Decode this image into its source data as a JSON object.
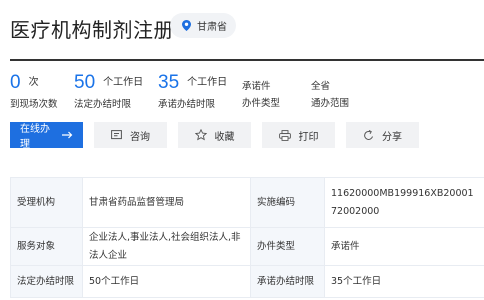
{
  "header": {
    "title": "医疗机构制剂注册",
    "location": "甘肃省"
  },
  "stats": [
    {
      "value": "0",
      "unit": "次",
      "label": "到现场次数"
    },
    {
      "value": "50",
      "unit": "个工作日",
      "label": "法定办结时限"
    },
    {
      "value": "35",
      "unit": "个工作日",
      "label": "承诺办结时限"
    },
    {
      "text": "承诺件",
      "label": "办件类型"
    },
    {
      "text": "全省",
      "label": "通办范围"
    }
  ],
  "actions": {
    "apply": "在线办理",
    "consult": "咨询",
    "favorite": "收藏",
    "print": "打印",
    "share": "分享"
  },
  "info": {
    "rows": [
      {
        "k1": "受理机构",
        "v1": "甘肃省药品监督管理局",
        "k2": "实施编码",
        "v2": "11620000MB199916XB2000172002000"
      },
      {
        "k1": "服务对象",
        "v1": "企业法人,事业法人,社会组织法人,非法人企业",
        "k2": "办件类型",
        "v2": "承诺件"
      },
      {
        "k1": "法定办结时限",
        "v1": "50个工作日",
        "k2": "承诺办结时限",
        "v2": "35个工作日"
      }
    ]
  },
  "colors": {
    "accent": "#1e6fe0",
    "number": "#1a73e8"
  }
}
